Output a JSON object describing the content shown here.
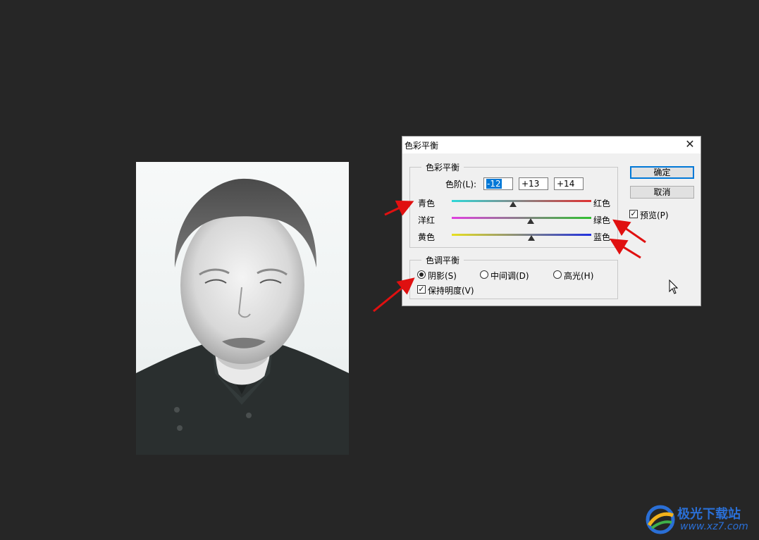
{
  "dialog": {
    "title": "色彩平衡",
    "close_glyph": "✕",
    "color_balance": {
      "legend": "色彩平衡",
      "levels_label": "色阶(L):",
      "levels": [
        "-12",
        "+13",
        "+14"
      ],
      "rows": [
        {
          "left": "青色",
          "right": "红色",
          "value": -12,
          "colors": [
            "#2fd8d8",
            "#e03030"
          ]
        },
        {
          "left": "洋红",
          "right": "绿色",
          "value": 13,
          "colors": [
            "#e040e0",
            "#30c030"
          ]
        },
        {
          "left": "黄色",
          "right": "蓝色",
          "value": 14,
          "colors": [
            "#e8e020",
            "#2030e0"
          ]
        }
      ],
      "range": [
        -100,
        100
      ]
    },
    "tone_balance": {
      "legend": "色调平衡",
      "options": [
        {
          "label": "阴影(S)",
          "selected": true
        },
        {
          "label": "中间调(D)",
          "selected": false
        },
        {
          "label": "高光(H)",
          "selected": false
        }
      ],
      "preserve_luminosity": {
        "label": "保持明度(V)",
        "checked": true
      }
    },
    "buttons": {
      "ok": "确定",
      "cancel": "取消"
    },
    "preview": {
      "label": "预览(P)",
      "checked": true
    }
  },
  "check_glyph": "✓",
  "watermark": {
    "name": "极光下载站",
    "url": "www.xz7.com"
  },
  "accent_color": "#0078d7",
  "annotation_color": "#e01010"
}
